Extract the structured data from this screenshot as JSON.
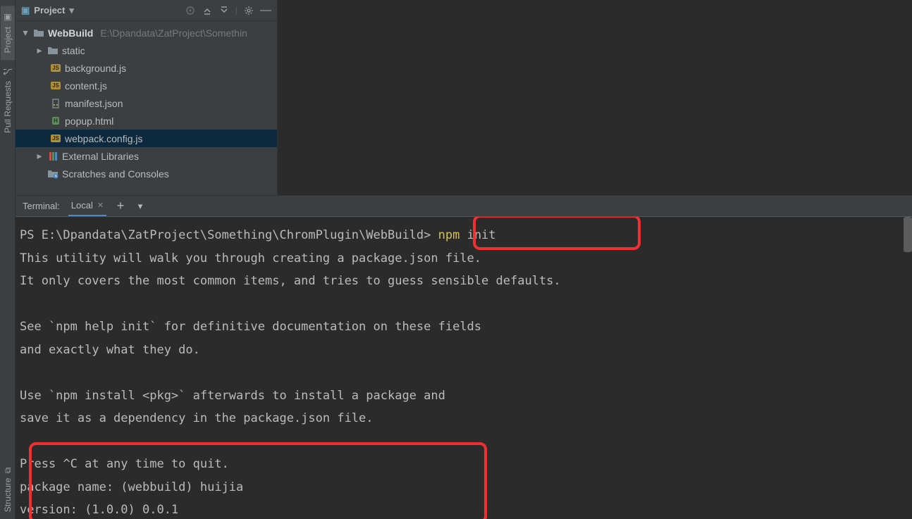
{
  "gutter": {
    "project": "Project",
    "pull_requests": "Pull Requests",
    "structure": "Structure"
  },
  "project_panel": {
    "title": "Project",
    "root": {
      "name": "WebBuild",
      "path": "E:\\Dpandata\\ZatProject\\Somethin"
    },
    "items": [
      {
        "name": "static",
        "type": "folder"
      },
      {
        "name": "background.js",
        "type": "js"
      },
      {
        "name": "content.js",
        "type": "js"
      },
      {
        "name": "manifest.json",
        "type": "json"
      },
      {
        "name": "popup.html",
        "type": "html"
      },
      {
        "name": "webpack.config.js",
        "type": "js",
        "selected": true
      }
    ],
    "external_libs": "External Libraries",
    "scratches": "Scratches and Consoles"
  },
  "terminal": {
    "label": "Terminal:",
    "tab": "Local",
    "lines": {
      "prompt_pre": "PS E:\\Dpandata\\ZatProject\\Something\\ChromPlugin\\WebBuild> ",
      "cmd_npm": "npm",
      "cmd_init": " init",
      "l1": "This utility will walk you through creating a package.json file.",
      "l2": "It only covers the most common items, and tries to guess sensible defaults.",
      "l3": "",
      "l4": "See `npm help init` for definitive documentation on these fields",
      "l5": "and exactly what they do.",
      "l6": "",
      "l7": "Use `npm install <pkg>` afterwards to install a package and",
      "l8": "save it as a dependency in the package.json file.",
      "l9": "",
      "l10": "Press ^C at any time to quit.",
      "l11": "package name: (webbuild) huijia",
      "l12": "version: (1.0.0) 0.0.1"
    }
  }
}
